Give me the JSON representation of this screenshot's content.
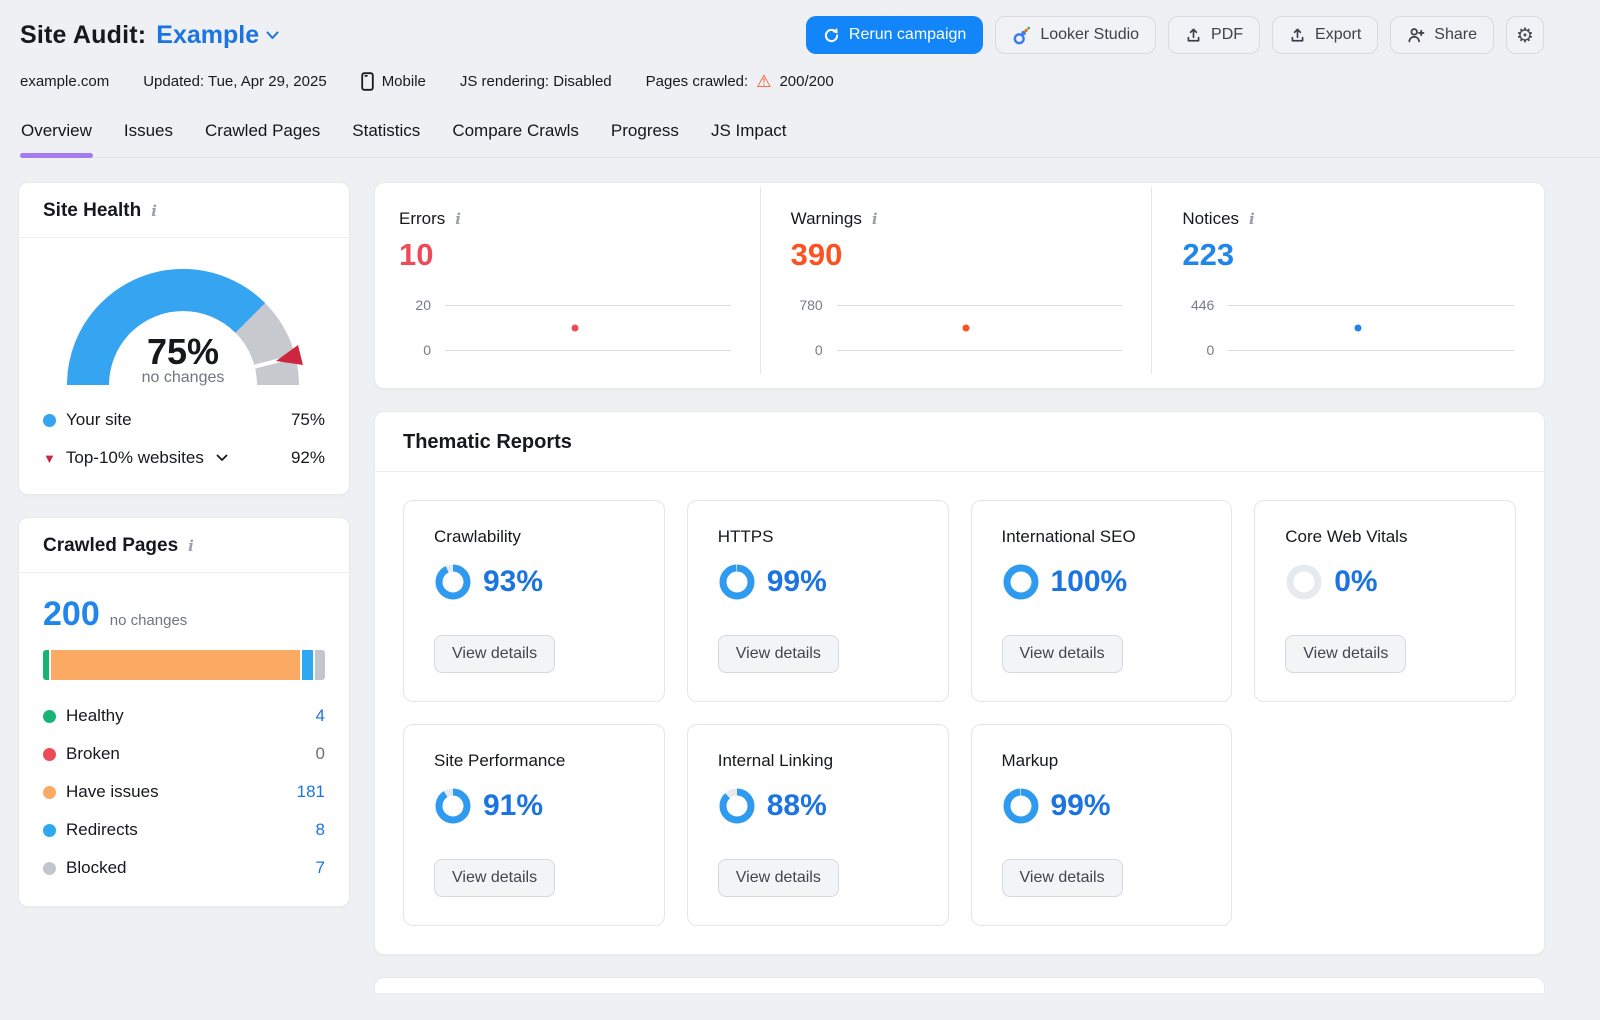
{
  "header": {
    "title": "Site Audit:",
    "campaign_name": "Example",
    "buttons": {
      "rerun": "Rerun campaign",
      "looker": "Looker Studio",
      "pdf": "PDF",
      "export": "Export",
      "share": "Share"
    },
    "meta": {
      "domain": "example.com",
      "updated": "Updated: Tue, Apr 29, 2025",
      "device": "Mobile",
      "js_rendering": "JS rendering: Disabled",
      "pages_crawled_label": "Pages crawled:",
      "pages_crawled_value": "200/200"
    }
  },
  "tabs": [
    {
      "label": "Overview",
      "active": true
    },
    {
      "label": "Issues",
      "active": false
    },
    {
      "label": "Crawled Pages",
      "active": false
    },
    {
      "label": "Statistics",
      "active": false
    },
    {
      "label": "Compare Crawls",
      "active": false
    },
    {
      "label": "Progress",
      "active": false
    },
    {
      "label": "JS Impact",
      "active": false
    }
  ],
  "site_health": {
    "title": "Site Health",
    "score_pct": 75,
    "score_label": "75%",
    "change_label": "no changes",
    "benchmark_pct": 92,
    "legend": [
      {
        "label": "Your site",
        "value": "75%",
        "marker_color": "#35a5f1"
      },
      {
        "label": "Top-10% websites",
        "value": "92%",
        "marker_color": "#ce2640"
      }
    ]
  },
  "crawled_pages": {
    "title": "Crawled Pages",
    "total": "200",
    "change_label": "no changes",
    "legend": [
      {
        "label": "Healthy",
        "value": "4",
        "color": "#18b476",
        "link": true
      },
      {
        "label": "Broken",
        "value": "0",
        "color": "#ed4b5a",
        "link": false
      },
      {
        "label": "Have issues",
        "value": "181",
        "color": "#fbaa64",
        "link": true
      },
      {
        "label": "Redirects",
        "value": "8",
        "color": "#2fa8f4",
        "link": true
      },
      {
        "label": "Blocked",
        "value": "7",
        "color": "#c3c7cd",
        "link": true
      }
    ]
  },
  "issue_panels": [
    {
      "label": "Errors",
      "value": "10",
      "axis_max": "20",
      "axis_min": "0",
      "color": "#ed4b5a"
    },
    {
      "label": "Warnings",
      "value": "390",
      "axis_max": "780",
      "axis_min": "0",
      "color": "#fc5121"
    },
    {
      "label": "Notices",
      "value": "223",
      "axis_max": "446",
      "axis_min": "0",
      "color": "#2186eb"
    }
  ],
  "thematic": {
    "title": "Thematic Reports",
    "button_label": "View details",
    "cards": [
      {
        "title": "Crawlability",
        "pct": 93,
        "pct_label": "93%"
      },
      {
        "title": "HTTPS",
        "pct": 99,
        "pct_label": "99%"
      },
      {
        "title": "International SEO",
        "pct": 100,
        "pct_label": "100%"
      },
      {
        "title": "Core Web Vitals",
        "pct": 0,
        "pct_label": "0%"
      },
      {
        "title": "Site Performance",
        "pct": 91,
        "pct_label": "91%"
      },
      {
        "title": "Internal Linking",
        "pct": 88,
        "pct_label": "88%"
      },
      {
        "title": "Markup",
        "pct": 99,
        "pct_label": "99%"
      }
    ]
  },
  "colors": {
    "accent_blue": "#1c74e0",
    "bright_blue": "#2186eb",
    "donut_blue": "#2e9bf0",
    "donut_track": "#e6e9ed",
    "gauge_blue": "#35a5f1",
    "gauge_gray": "#c6cacf",
    "benchmark_red": "#ce2640",
    "error_red": "#ed4b5a",
    "warning_orange": "#fc5121",
    "notice_blue": "#2186eb",
    "tab_purple": "#a47ced",
    "rerun_button_blue": "#1285f8",
    "warn_triangle_orange": "#f4501e"
  }
}
